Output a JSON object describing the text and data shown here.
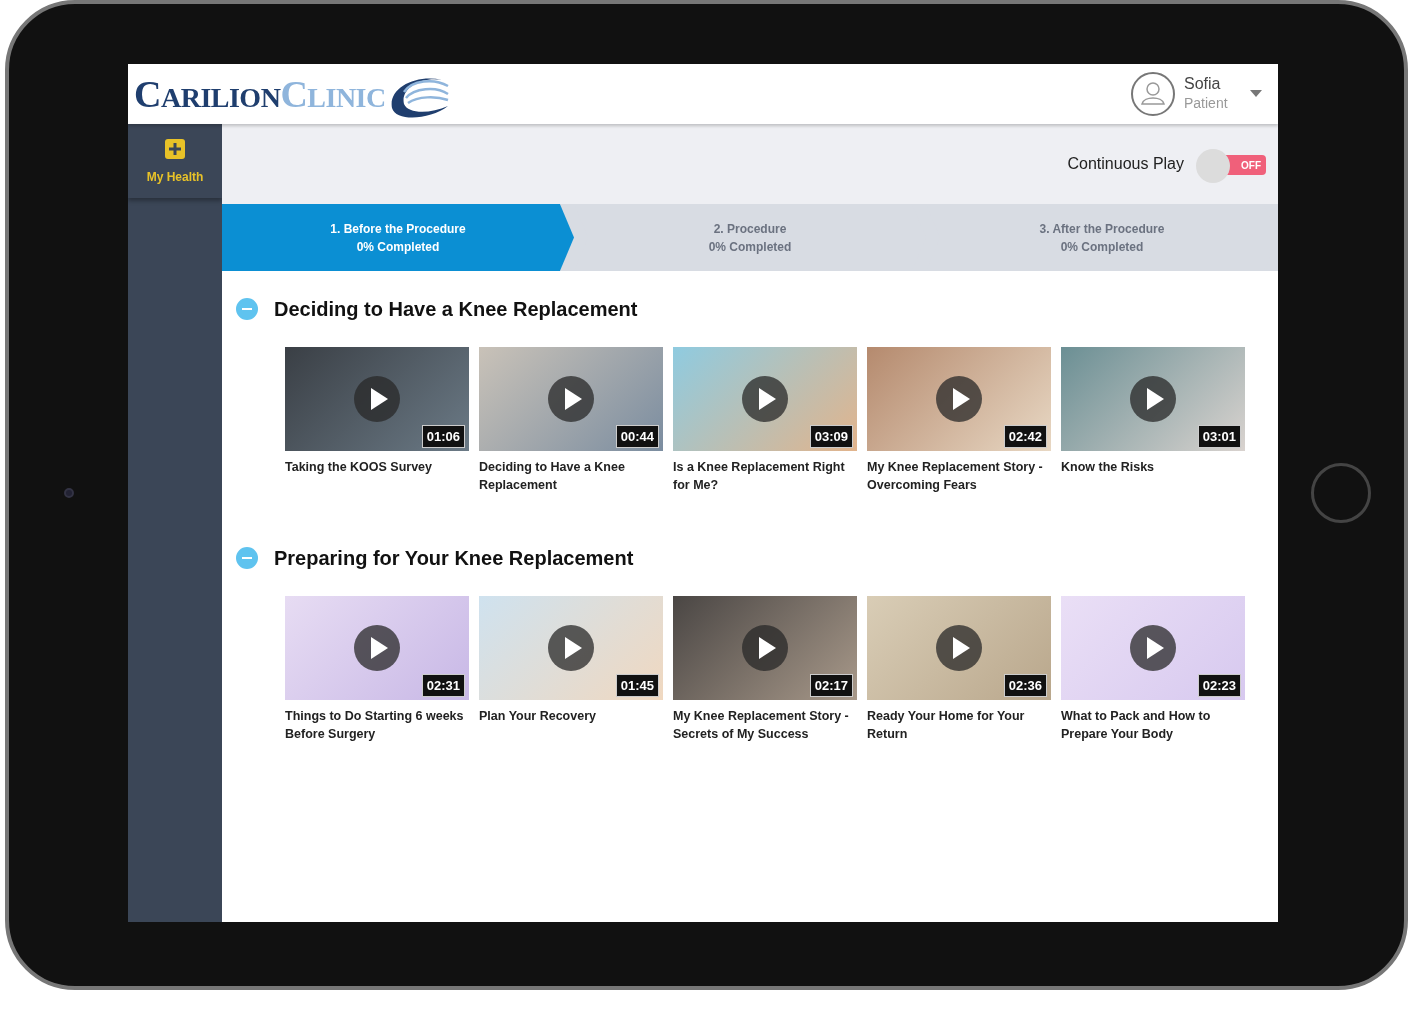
{
  "brand": {
    "word_1": "CARILION",
    "word_2": "CLINIC"
  },
  "user": {
    "name": "Sofia",
    "role": "Patient"
  },
  "sidebar": {
    "items": [
      {
        "label": "My Health",
        "selected": true
      }
    ]
  },
  "continuous_play": {
    "label": "Continuous Play",
    "on": false,
    "state_label": "OFF"
  },
  "steps": [
    {
      "title": "1. Before the Procedure",
      "progress": "0% Completed",
      "selected": true
    },
    {
      "title": "2. Procedure",
      "progress": "0% Completed",
      "selected": false
    },
    {
      "title": "3. After the Procedure",
      "progress": "0% Completed",
      "selected": false
    }
  ],
  "sections": [
    {
      "title": "Deciding to Have a Knee Replacement",
      "expanded": true,
      "videos": [
        {
          "title": "Taking the KOOS Survey",
          "duration": "01:06"
        },
        {
          "title": "Deciding to Have a Knee Replacement",
          "duration": "00:44"
        },
        {
          "title": "Is a Knee Replacement Right for Me?",
          "duration": "03:09"
        },
        {
          "title": "My Knee Replacement Story - Overcoming Fears",
          "duration": "02:42"
        },
        {
          "title": "Know the Risks",
          "duration": "03:01"
        }
      ]
    },
    {
      "title": "Preparing for Your Knee Replacement",
      "expanded": true,
      "videos": [
        {
          "title": "Things to Do Starting 6 weeks Before Surgery",
          "duration": "02:31"
        },
        {
          "title": "Plan Your Recovery",
          "duration": "01:45"
        },
        {
          "title": "My Knee Replacement Story - Secrets of My Success",
          "duration": "02:17"
        },
        {
          "title": "Ready Your Home for Your Return",
          "duration": "02:36"
        },
        {
          "title": "What to Pack and How to Prepare Your Body",
          "duration": "02:23"
        }
      ]
    }
  ]
}
